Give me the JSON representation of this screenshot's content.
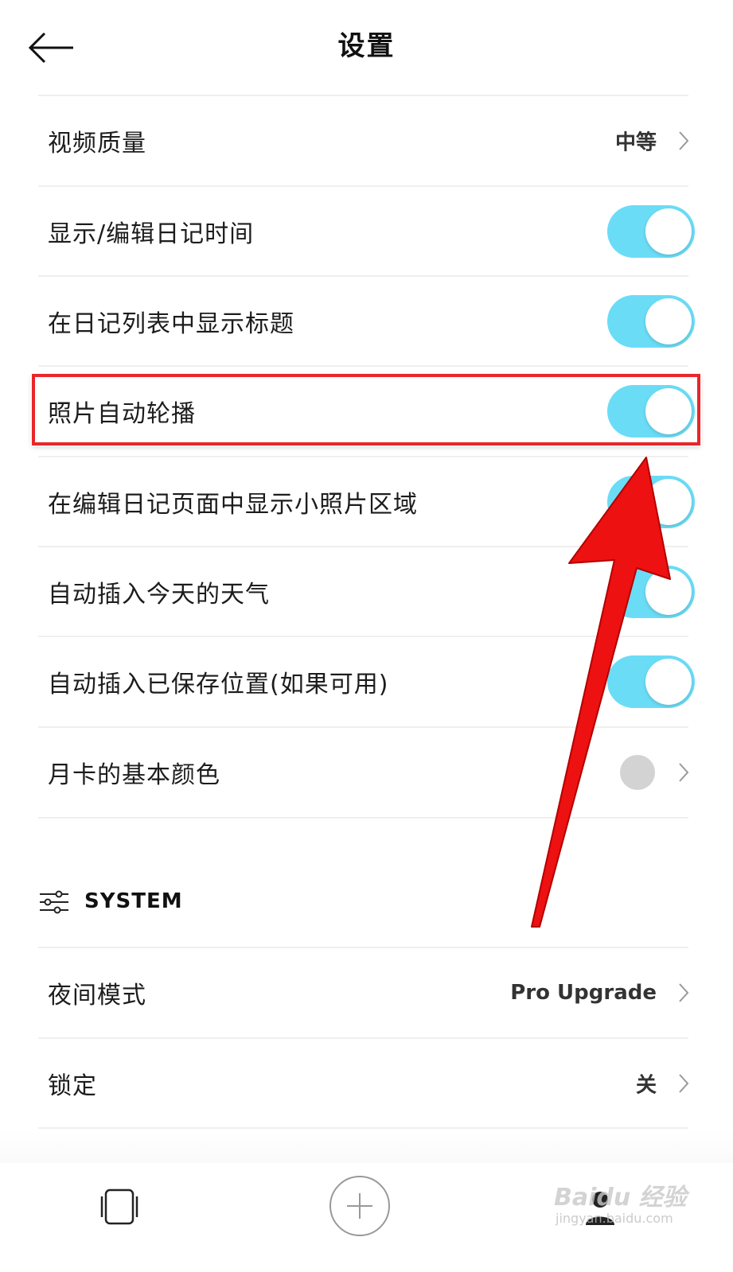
{
  "header": {
    "title": "设置"
  },
  "rows": [
    {
      "label": "视频质量",
      "value": "中等"
    },
    {
      "label": "显示/编辑日记时间",
      "toggle": "on"
    },
    {
      "label": "在日记列表中显示标题",
      "toggle": "on"
    },
    {
      "label": "照片自动轮播",
      "toggle": "on"
    },
    {
      "label": "在编辑日记页面中显示小照片区域",
      "toggle": "on"
    },
    {
      "label": "自动插入今天的天气",
      "toggle": "on"
    },
    {
      "label": "自动插入已保存位置(如果可用)",
      "toggle": "on"
    },
    {
      "label": "月卡的基本颜色",
      "color": "#d3d3d3"
    }
  ],
  "system_section": {
    "title": "SYSTEM",
    "rows": [
      {
        "label": "夜间模式",
        "value": "Pro Upgrade"
      },
      {
        "label": "锁定",
        "value": "关"
      }
    ]
  },
  "colors": {
    "accent": "#6bdcf6",
    "highlight": "#e8262b",
    "arrow": "#ee1111"
  },
  "icons": [
    "back-arrow-icon",
    "chevron-right-icon",
    "sliders-icon",
    "diary-icon",
    "add-icon",
    "profile-icon"
  ],
  "watermark": {
    "main": "Baidu 经验",
    "sub": "jingyan.baidu.com"
  }
}
